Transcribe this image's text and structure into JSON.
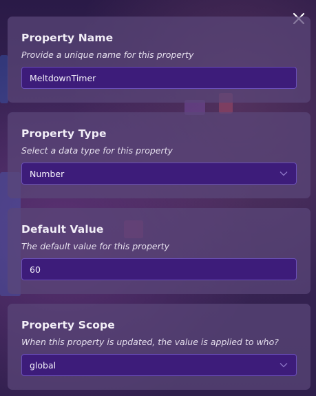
{
  "close": {
    "icon": "close-icon"
  },
  "panels": {
    "name": {
      "title": "Property Name",
      "description": "Provide a unique name for this property",
      "value": "MeltdownTimer"
    },
    "type": {
      "title": "Property Type",
      "description": "Select a data type for this property",
      "value": "Number",
      "icon": "chevron-down-icon"
    },
    "default": {
      "title": "Default Value",
      "description": "The default value for this property",
      "value": "60"
    },
    "scope": {
      "title": "Property Scope",
      "description": "When this property is updated, the value is applied to who?",
      "value": "global",
      "icon": "chevron-down-icon"
    }
  },
  "colors": {
    "panel": "#5a4678",
    "field": "#3d1c7a",
    "field_border": "#6a4fb8",
    "text": "#f2eef7"
  }
}
